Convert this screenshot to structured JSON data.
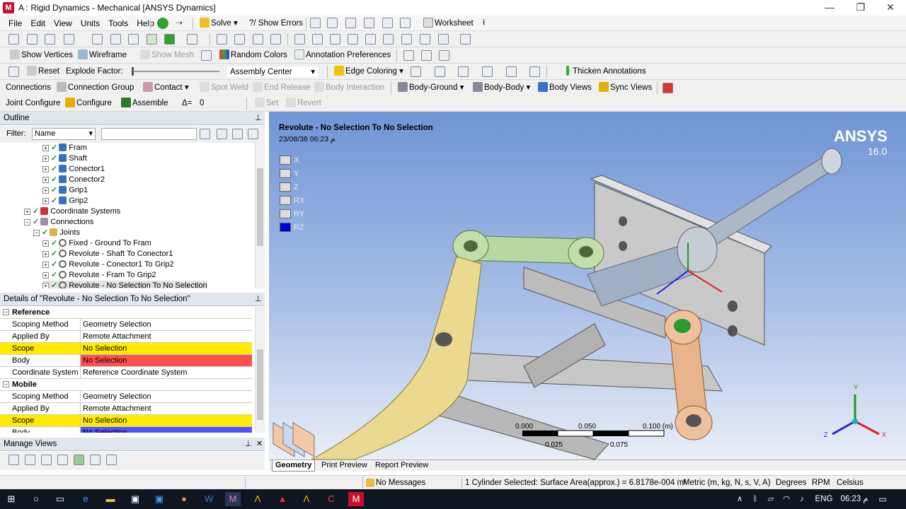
{
  "window": {
    "title": "A : Rigid Dynamics - Mechanical [ANSYS Dynamics]",
    "app_icon_text": "M",
    "minimize": "—",
    "restore": "❐",
    "close": "✕"
  },
  "menu": [
    "File",
    "Edit",
    "View",
    "Units",
    "Tools",
    "Help"
  ],
  "toolbar1": {
    "solve": "Solve",
    "show_errors": "?/ Show Errors",
    "worksheet": "Worksheet"
  },
  "toolbar3": {
    "show_vertices": "Show Vertices",
    "wireframe": "Wireframe",
    "show_mesh": "Show Mesh",
    "random_colors": "Random Colors",
    "annotation_preferences": "Annotation Preferences"
  },
  "toolbar4": {
    "reset": "Reset",
    "explode_factor": "Explode Factor:",
    "assembly_center": "Assembly Center",
    "edge_coloring": "Edge Coloring",
    "thicken_annotations": "Thicken Annotations"
  },
  "toolbar5": {
    "connections": "Connections",
    "connection_group": "Connection Group",
    "contact": "Contact",
    "spot_weld": "Spot Weld",
    "end_release": "End Release",
    "body_interaction": "Body Interaction",
    "body_ground": "Body-Ground",
    "body_body": "Body-Body",
    "body_views": "Body Views",
    "sync_views": "Sync Views"
  },
  "toolbar6": {
    "joint_configure": "Joint Configure",
    "configure": "Configure",
    "assemble": "Assemble",
    "delta": "Δ=",
    "delta_value": "0",
    "set": "Set",
    "revert": "Revert"
  },
  "outline": {
    "title": "Outline",
    "pin": "⊥",
    "filter_label": "Filter:",
    "filter_value": "Name",
    "tree": [
      {
        "label": "Fram",
        "indent": 4,
        "icon": "cube"
      },
      {
        "label": "Shaft",
        "indent": 4,
        "icon": "cube"
      },
      {
        "label": "Conector1",
        "indent": 4,
        "icon": "cube"
      },
      {
        "label": "Conector2",
        "indent": 4,
        "icon": "cube"
      },
      {
        "label": "Grip1",
        "indent": 4,
        "icon": "cube"
      },
      {
        "label": "Grip2",
        "indent": 4,
        "icon": "cube"
      },
      {
        "label": "Coordinate Systems",
        "indent": 2,
        "icon": "axes"
      },
      {
        "label": "Connections",
        "indent": 2,
        "icon": "conn"
      },
      {
        "label": "Joints",
        "indent": 3,
        "icon": "folder"
      },
      {
        "label": "Fixed - Ground To Fram",
        "indent": 4,
        "icon": "joint"
      },
      {
        "label": "Revolute - Shaft To Conector1",
        "indent": 4,
        "icon": "joint"
      },
      {
        "label": "Revolute - Conector1 To Grip2",
        "indent": 4,
        "icon": "joint"
      },
      {
        "label": "Revolute - Fram To Grip2",
        "indent": 4,
        "icon": "joint"
      },
      {
        "label": "Revolute - No Selection To No Selection",
        "indent": 4,
        "icon": "joint"
      }
    ]
  },
  "details": {
    "title": "Details of \"Revolute - No Selection To No Selection\"",
    "rows": [
      {
        "group": true,
        "k": "Reference",
        "v": ""
      },
      {
        "k": "Scoping Method",
        "v": "Geometry Selection",
        "hl": ""
      },
      {
        "k": "Applied By",
        "v": "Remote Attachment",
        "hl": ""
      },
      {
        "k": "Scope",
        "v": "No Selection",
        "hl": "yel"
      },
      {
        "k": "Body",
        "v": "No Selection",
        "hl": "red"
      },
      {
        "k": "Coordinate System",
        "v": "Reference Coordinate System",
        "hl": ""
      },
      {
        "group": true,
        "k": "Mobile",
        "v": ""
      },
      {
        "k": "Scoping Method",
        "v": "Geometry Selection",
        "hl": ""
      },
      {
        "k": "Applied By",
        "v": "Remote Attachment",
        "hl": ""
      },
      {
        "k": "Scope",
        "v": "No Selection",
        "hl": "yel"
      },
      {
        "k": "Body",
        "v": "No Selection",
        "hl": "blu"
      }
    ]
  },
  "manage_views": {
    "title": "Manage Views",
    "close": "✕"
  },
  "viewport": {
    "heading": "Revolute - No Selection To No Selection",
    "timestamp": "23/08/38 06:23 م",
    "brand": "ANSYS",
    "version": "16.0",
    "dofs": [
      {
        "label": "X",
        "active": false
      },
      {
        "label": "Y",
        "active": false
      },
      {
        "label": "Z",
        "active": false
      },
      {
        "label": "RX",
        "active": false
      },
      {
        "label": "RY",
        "active": false
      },
      {
        "label": "RZ",
        "active": true
      }
    ],
    "scale": {
      "top_labels": [
        "0.000",
        "0.050",
        "0.100 (m)"
      ],
      "bottom_labels": [
        "0.025",
        "0.075"
      ]
    },
    "triad": {
      "x": "X",
      "y": "Y",
      "z": "Z"
    }
  },
  "tabs": [
    "Geometry",
    "Print Preview",
    "Report Preview"
  ],
  "status": {
    "messages": "No Messages",
    "selection": "1 Cylinder Selected: Surface Area(approx.) = 6.8178e-004 m²",
    "units": "Metric (m, kg, N, s, V, A)",
    "angle": "Degrees",
    "speed": "RPM",
    "temp": "Celsius"
  },
  "taskbar": {
    "lang": "ENG",
    "time": "06:23 م"
  },
  "colors": {
    "viewport_top": "#6f95d6",
    "scope_yellow": "#ffea00",
    "body_red": "#ff5050",
    "body_blue": "#5050ff",
    "panel_header": "#dfe6ee"
  }
}
